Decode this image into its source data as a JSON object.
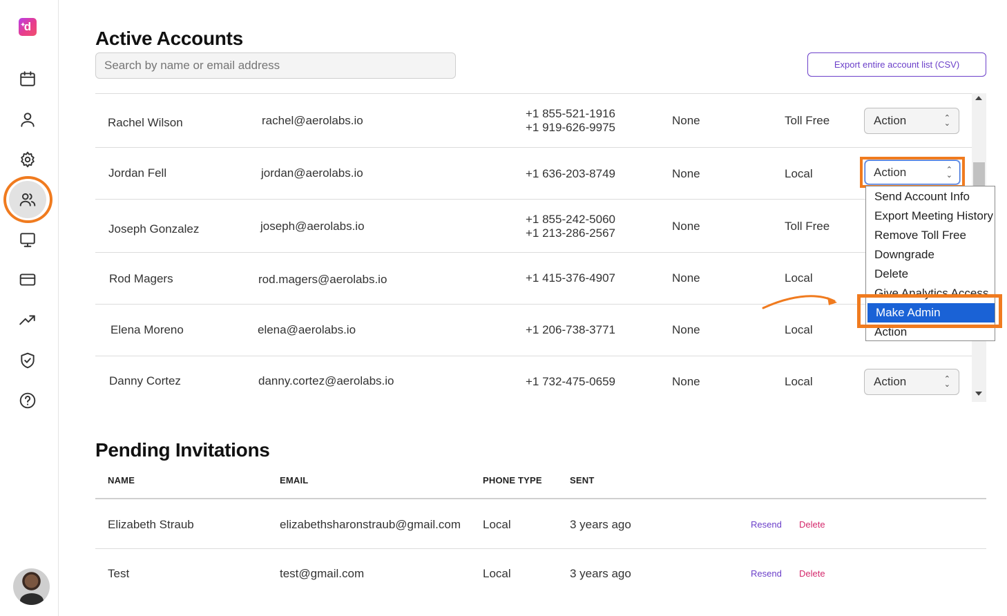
{
  "sidebar": {
    "logo_letter": "d",
    "logo_spark": "✦",
    "icons": [
      "calendar-icon",
      "user-icon",
      "gear-icon",
      "users-icon",
      "monitor-icon",
      "credit-card-icon",
      "trending-up-icon",
      "shield-check-icon",
      "help-circle-icon"
    ],
    "active_icon": "users-icon"
  },
  "colors": {
    "accent": "#6b3fc9",
    "highlight": "#f07b1f",
    "delete": "#d4286b",
    "selected": "#1a62d6"
  },
  "active_accounts": {
    "title": "Active Accounts",
    "search_placeholder": "Search by name or email address",
    "export_label": "Export entire account list (CSV)",
    "rows": [
      {
        "name": "Rachel Wilson",
        "email": "rachel@aerolabs.io",
        "phones": [
          "+1 855-521-1916",
          "+1 919-626-9975"
        ],
        "plan": "None",
        "phone_type": "Toll Free",
        "action": "Action"
      },
      {
        "name": "Jordan Fell",
        "email": "jordan@aerolabs.io",
        "phones": [
          "+1 636-203-8749"
        ],
        "plan": "None",
        "phone_type": "Local",
        "action": "Action"
      },
      {
        "name": "Joseph Gonzalez",
        "email": "joseph@aerolabs.io",
        "phones": [
          "+1 855-242-5060",
          "+1 213-286-2567"
        ],
        "plan": "None",
        "phone_type": "Toll Free",
        "action": "Action"
      },
      {
        "name": "Rod Magers",
        "email": "rod.magers@aerolabs.io",
        "phones": [
          "+1 415-376-4907"
        ],
        "plan": "None",
        "phone_type": "Local",
        "action": "Action"
      },
      {
        "name": "Elena Moreno",
        "email": "elena@aerolabs.io",
        "phones": [
          "+1 206-738-3771"
        ],
        "plan": "None",
        "phone_type": "Local",
        "action": "Action"
      },
      {
        "name": "Danny Cortez",
        "email": "danny.cortez@aerolabs.io",
        "phones": [
          "+1 732-475-0659"
        ],
        "plan": "None",
        "phone_type": "Local",
        "action": "Action"
      }
    ],
    "dropdown": {
      "selected_value": "Action",
      "options": [
        "Send Account Info",
        "Export Meeting History",
        "Remove Toll Free",
        "Downgrade",
        "Delete",
        "Give Analytics Access",
        "Make Admin",
        "Action"
      ],
      "highlighted_option": "Make Admin"
    }
  },
  "pending": {
    "title": "Pending Invitations",
    "headers": [
      "NAME",
      "EMAIL",
      "PHONE TYPE",
      "SENT"
    ],
    "rows": [
      {
        "name": "Elizabeth Straub",
        "email": "elizabethsharonstraub@gmail.com",
        "phone_type": "Local",
        "sent": "3 years ago",
        "resend": "Resend",
        "delete": "Delete"
      },
      {
        "name": "Test",
        "email": "test@gmail.com",
        "phone_type": "Local",
        "sent": "3 years ago",
        "resend": "Resend",
        "delete": "Delete"
      }
    ]
  }
}
